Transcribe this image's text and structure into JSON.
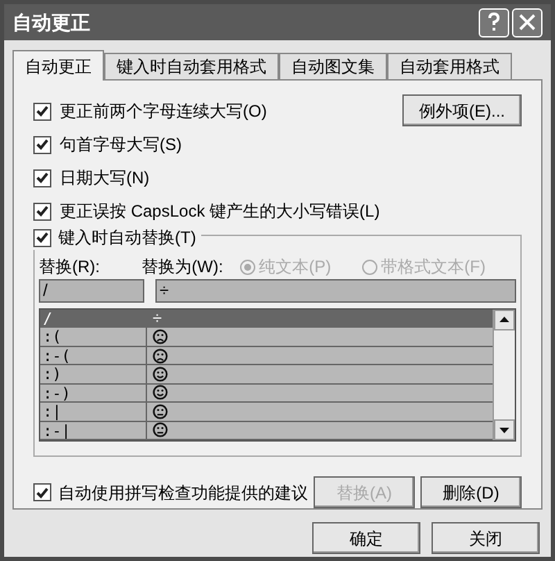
{
  "window": {
    "title": "自动更正"
  },
  "tabs": [
    {
      "label": "自动更正",
      "selected": true
    },
    {
      "label": "键入时自动套用格式",
      "selected": false
    },
    {
      "label": "自动图文集",
      "selected": false
    },
    {
      "label": "自动套用格式",
      "selected": false
    }
  ],
  "options": [
    {
      "label": "更正前两个字母连续大写(O)",
      "checked": true
    },
    {
      "label": "句首字母大写(S)",
      "checked": true
    },
    {
      "label": "日期大写(N)",
      "checked": true
    },
    {
      "label": "更正误按 CapsLock 键产生的大小写错误(L)",
      "checked": true
    }
  ],
  "exceptions_button": "例外项(E)...",
  "replace_group": {
    "label": "键入时自动替换(T)",
    "checked": true,
    "replace_label": "替换(R):",
    "with_label": "替换为(W):",
    "formats": [
      {
        "label": "纯文本(P)",
        "selected": true,
        "disabled": true
      },
      {
        "label": "带格式文本(F)",
        "selected": false,
        "disabled": true
      }
    ],
    "replace_value": "/",
    "with_value": "÷",
    "rows": [
      {
        "from": "/",
        "kind": "text",
        "to": "÷",
        "selected": true
      },
      {
        "from": ":(",
        "kind": "frown",
        "selected": false
      },
      {
        "from": ":-(",
        "kind": "frown",
        "selected": false
      },
      {
        "from": ":)",
        "kind": "smile",
        "selected": false
      },
      {
        "from": ":-)",
        "kind": "smile",
        "selected": false
      },
      {
        "from": ":|",
        "kind": "neutral",
        "selected": false
      },
      {
        "from": ":-|",
        "kind": "neutral",
        "selected": false
      }
    ]
  },
  "spell_option": {
    "label": "自动使用拼写检查功能提供的建议",
    "checked": true
  },
  "replace_button": {
    "label": "替换(A)",
    "disabled": true
  },
  "delete_button": {
    "label": "删除(D)",
    "disabled": false
  },
  "buttons": [
    "确定",
    "关闭"
  ]
}
